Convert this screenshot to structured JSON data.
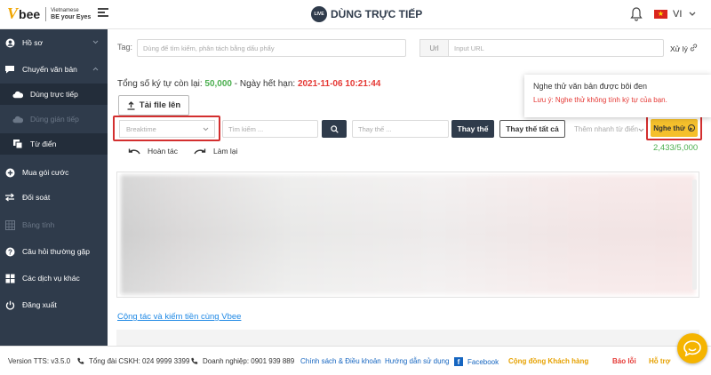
{
  "header": {
    "logo_v": "V",
    "logo_bee": "bee",
    "logo_tag_line1": "Vietnamese",
    "logo_tag_line2": "BE your Eyes",
    "live_badge": "LIVE",
    "title": "DÙNG TRỰC TIẾP",
    "language": "VI",
    "flag_star": "★"
  },
  "sidebar": {
    "items": [
      {
        "label": "Hồ sơ",
        "icon": "user-icon"
      },
      {
        "label": "Chuyển văn bản",
        "icon": "chat-icon"
      },
      {
        "label": "Dùng trực tiếp",
        "icon": "cloud-icon"
      },
      {
        "label": "Dùng gián tiếp",
        "icon": "cloud-upload-icon"
      },
      {
        "label": "Từ điển",
        "icon": "dictionary-icon"
      },
      {
        "label": "Mua gói cước",
        "icon": "plus-circle-icon"
      },
      {
        "label": "Đối soát",
        "icon": "exchange-icon"
      },
      {
        "label": "Bảng tính",
        "icon": "table-icon"
      },
      {
        "label": "Câu hỏi thường gặp",
        "icon": "question-icon"
      },
      {
        "label": "Các dịch vụ khác",
        "icon": "grid-icon"
      },
      {
        "label": "Đăng xuất",
        "icon": "power-icon"
      }
    ]
  },
  "toolbar": {
    "tag_label": "Tag:",
    "tag_placeholder": "Dùng để tìm kiếm, phân tách bằng dấu phẩy",
    "url_label": "Url",
    "url_placeholder": "Input URL",
    "process_label": "Xử lý",
    "quota_prefix": "Tổng số ký tự còn lại: ",
    "quota_value": "50,000",
    "expiry_prefix": " - Ngày hết hạn: ",
    "expiry_value": "2021-11-06 10:21:44",
    "upload_label": "Tải file lên",
    "break_placeholder": "Breaktime",
    "search_placeholder": "Tìm kiếm ...",
    "replace_placeholder": "Thay thế ...",
    "replace_label": "Thay thế",
    "replace_all_label": "Thay thế tất cả",
    "quick_add_label": "Thêm nhanh từ điển",
    "listen_label": "Nghe thử",
    "char_counter": "2,433/5,000",
    "undo_label": "Hoàn tác",
    "redo_label": "Làm lại"
  },
  "tooltip": {
    "title": "Nghe thử văn bản được bôi đen",
    "note": "Lưu ý: Nghe thử không tính ký tự của bạn."
  },
  "main": {
    "collab_link": "Cộng tác và kiếm tiền cùng Vbee"
  },
  "footer": {
    "version": "Version TTS: v3.5.0",
    "hotline": "Tổng đài CSKH: 024 9999 3399",
    "business": "Doanh nghiệp: 0901 939 889",
    "policy": "Chính sách & Điều khoản",
    "guide": "Hướng dẫn sử dụng",
    "facebook_letter": "f",
    "facebook": "Facebook",
    "community": "Cộng đồng Khách hàng",
    "report": "Báo lỗi",
    "support": "Hỗ trợ"
  },
  "colors": {
    "sidebar_bg": "#2f3b4b",
    "accent_yellow": "#f5c02c",
    "highlight_red": "#d32f2f",
    "success_green": "#4caf50",
    "link_blue": "#1e88e5"
  }
}
